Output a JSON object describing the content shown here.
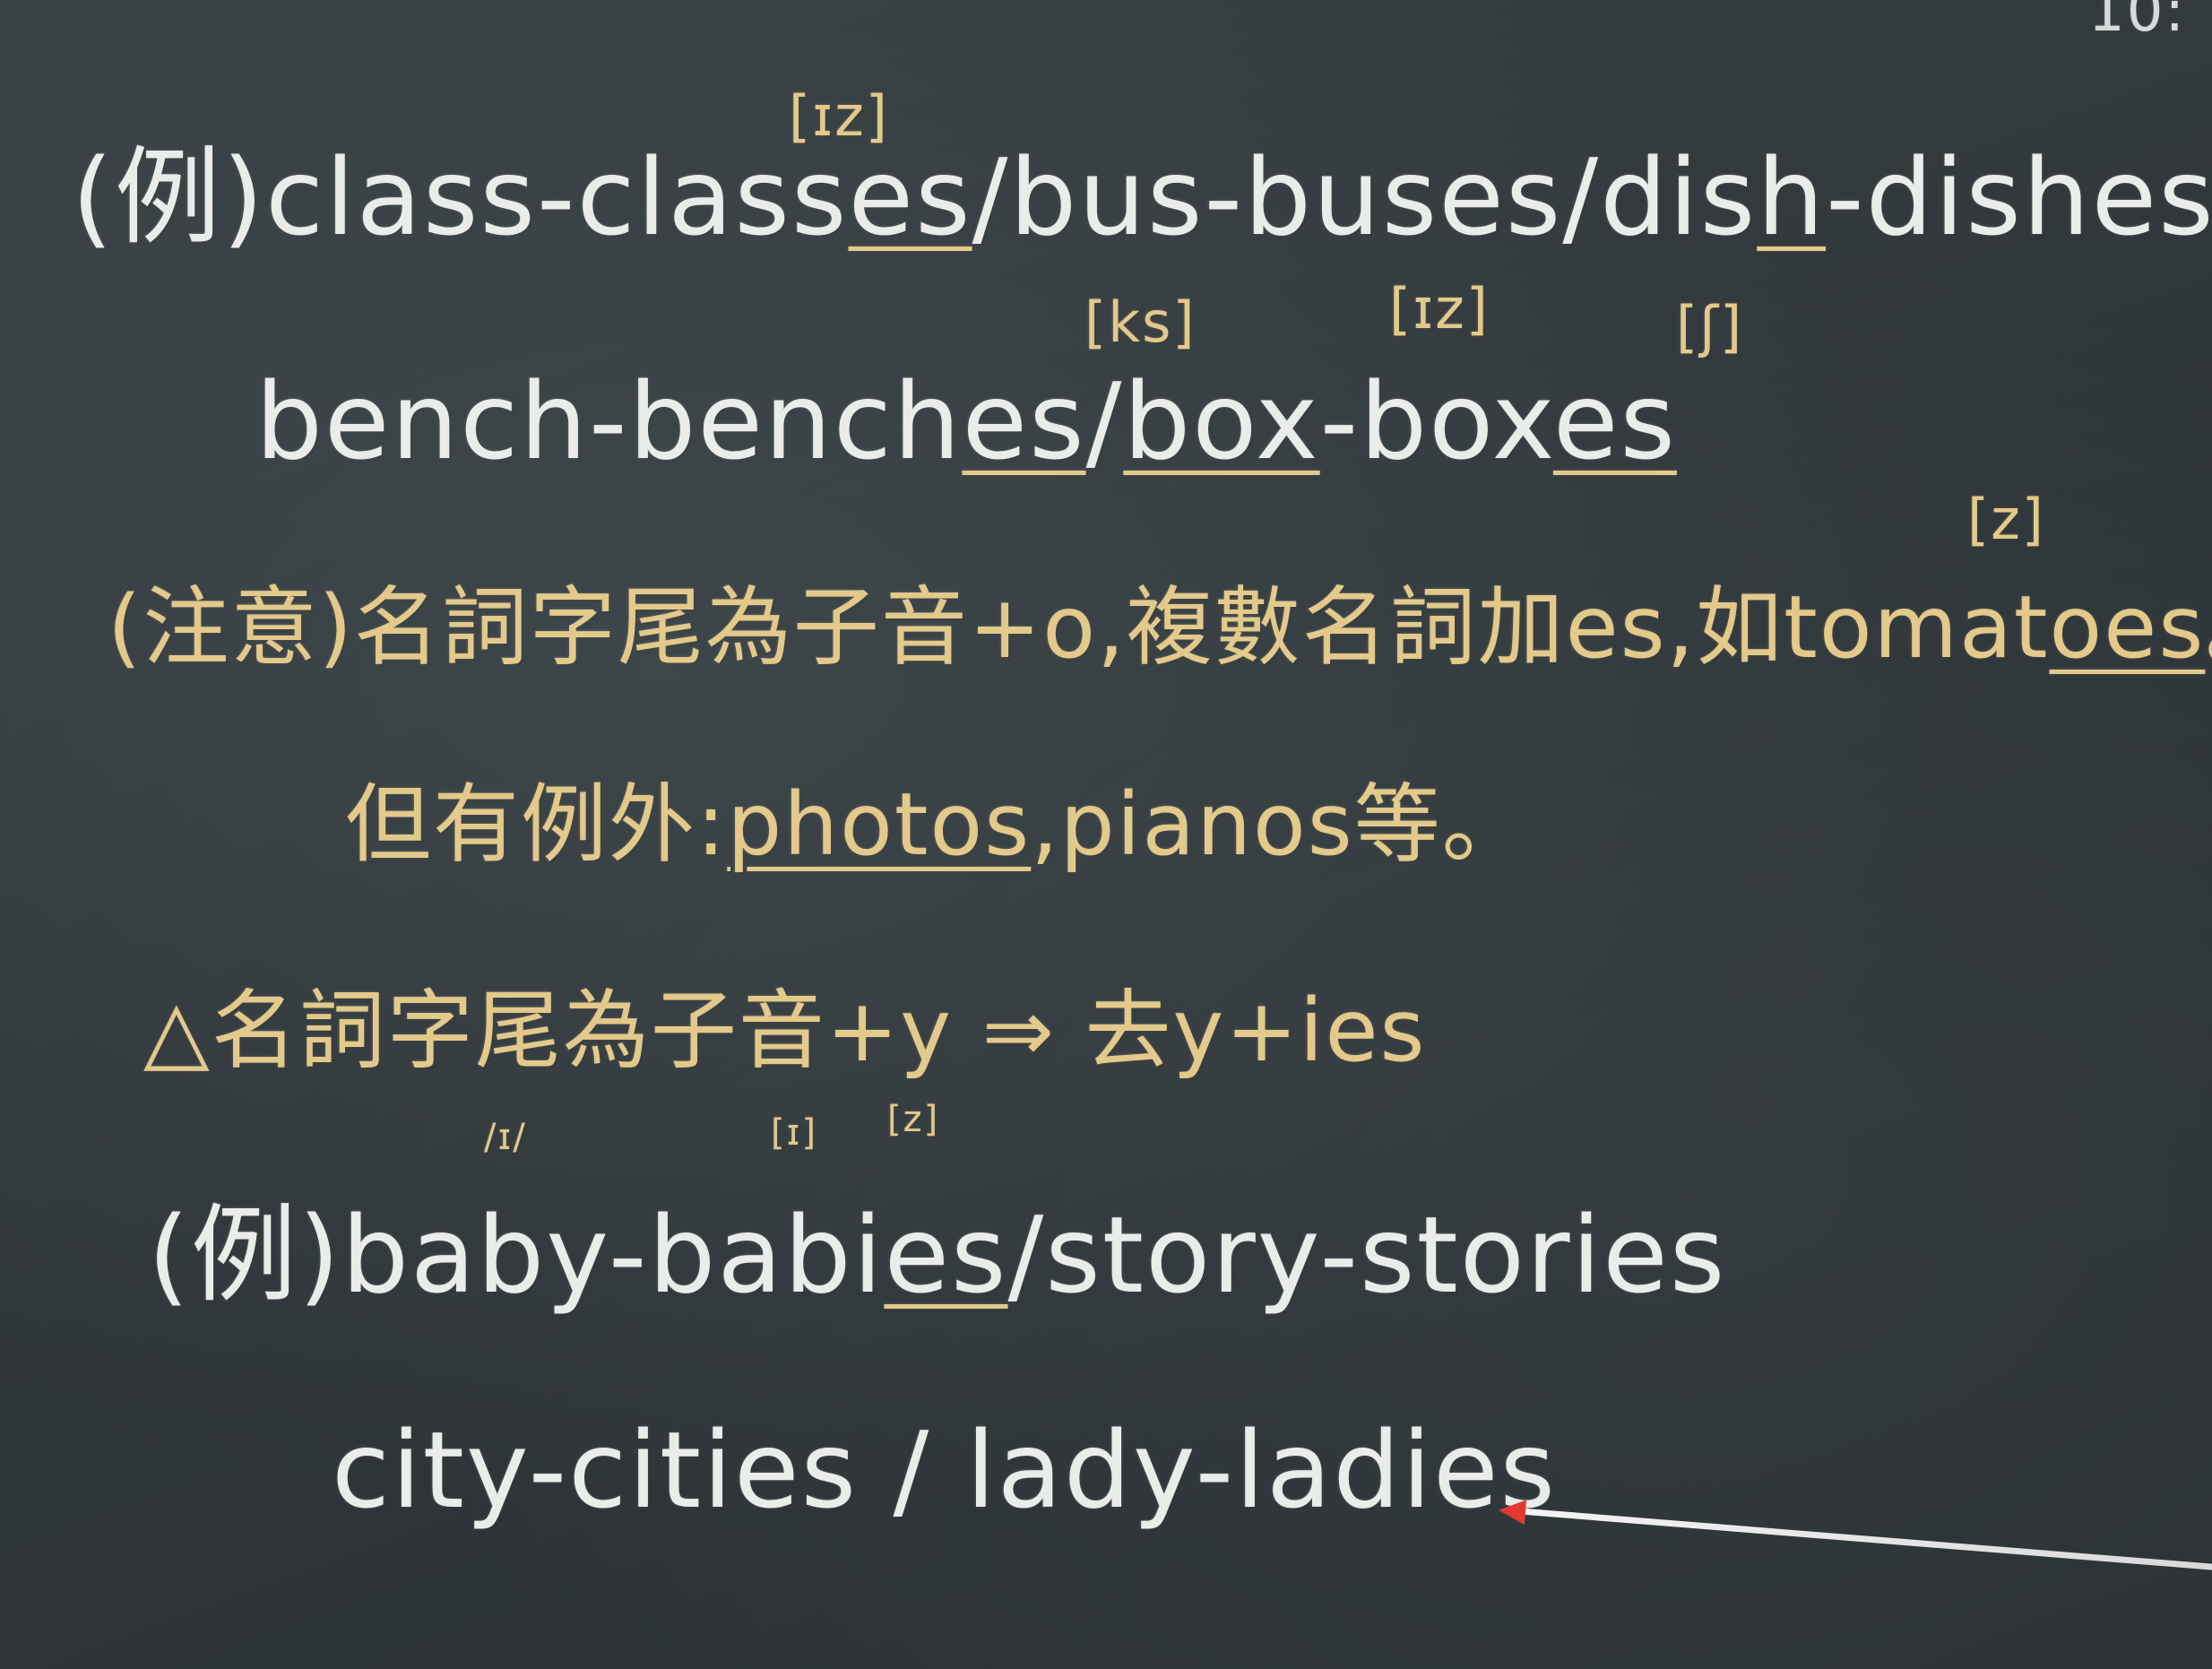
{
  "corner_text": "10:",
  "lines": {
    "l1_prefix": "(例)",
    "l1_a": "class-class",
    "l1_a_ul": "es",
    "l1_b": "/bus-buses/dis",
    "l1_b_ul": "h",
    "l1_c": "-dishes",
    "l2_a": "bench-bench",
    "l2_a_ul": "es",
    "l2_b": "/",
    "l2_b_ul": "box",
    "l2_c": "-box",
    "l2_c_ul": "es",
    "l3_a": "(注意)名詞字尾為子音+o,複數名詞加es,如tomat",
    "l3_a_ul": "oes",
    "l3_b": "。",
    "l4_a": "但有例外:",
    "l4_a_ul": "photos",
    "l4_b": ",pianos等。",
    "l5": "△名詞字尾為子音+y ⇒ 去y+ies",
    "l6_prefix": "(例)",
    "l6_a": "baby-babi",
    "l6_a_ul": "es",
    "l6_b": "/story-stories",
    "l7": "city-cities / lady-ladies"
  },
  "phonetics": {
    "iz1": "[ɪz]",
    "ks": "[ks]",
    "iz2": "[ɪz]",
    "sh": "[ʃ]",
    "z1": "[z]",
    "i1": "/ɪ/",
    "i2": "[ɪ]",
    "z2": "[z]"
  },
  "colors": {
    "chalk_white": "#e9ece9",
    "chalk_yellow": "#e3c98a",
    "board": "#30373a",
    "pointer_tip": "#e23a32"
  }
}
